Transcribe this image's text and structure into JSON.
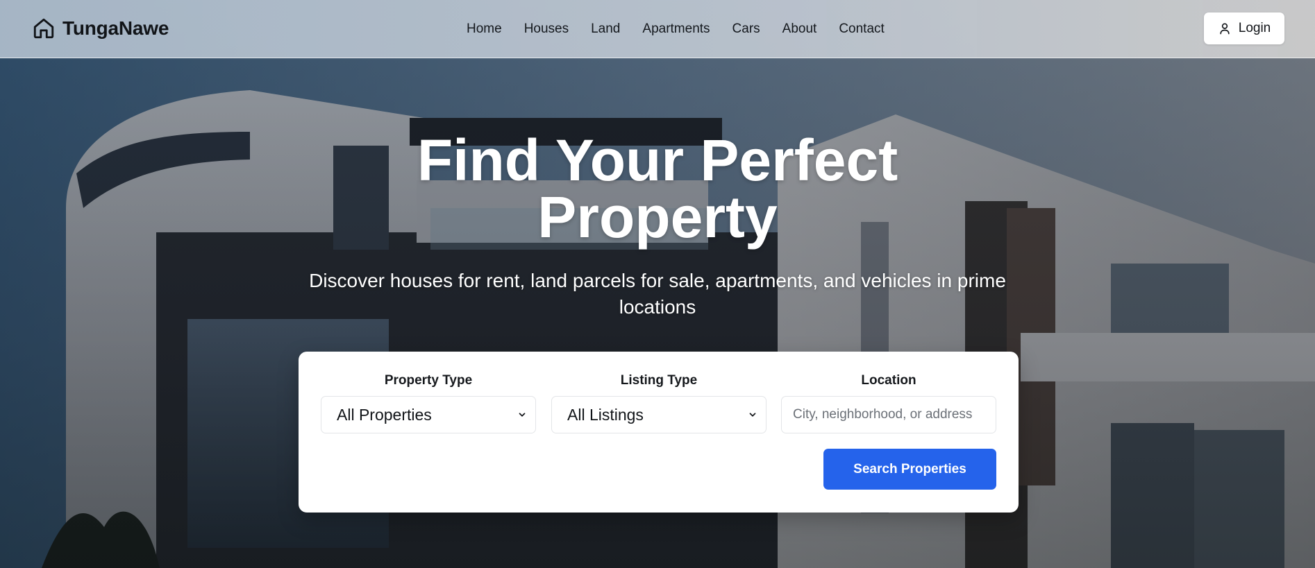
{
  "brand": {
    "name": "TungaNawe",
    "icon": "home-icon"
  },
  "nav": {
    "links": [
      "Home",
      "Houses",
      "Land",
      "Apartments",
      "Cars",
      "About",
      "Contact"
    ]
  },
  "login": {
    "label": "Login",
    "icon": "user-icon"
  },
  "hero": {
    "title": "Find Your Perfect Property",
    "subtitle": "Discover houses for rent, land parcels for sale, apartments, and vehicles in prime locations"
  },
  "search": {
    "property_type": {
      "label": "Property Type",
      "selected": "All Properties"
    },
    "listing_type": {
      "label": "Listing Type",
      "selected": "All Listings"
    },
    "location": {
      "label": "Location",
      "placeholder": "City, neighborhood, or address",
      "value": ""
    },
    "submit_label": "Search Properties"
  },
  "colors": {
    "accent": "#2563eb",
    "text_dark": "#111418",
    "card_bg": "#ffffff"
  }
}
